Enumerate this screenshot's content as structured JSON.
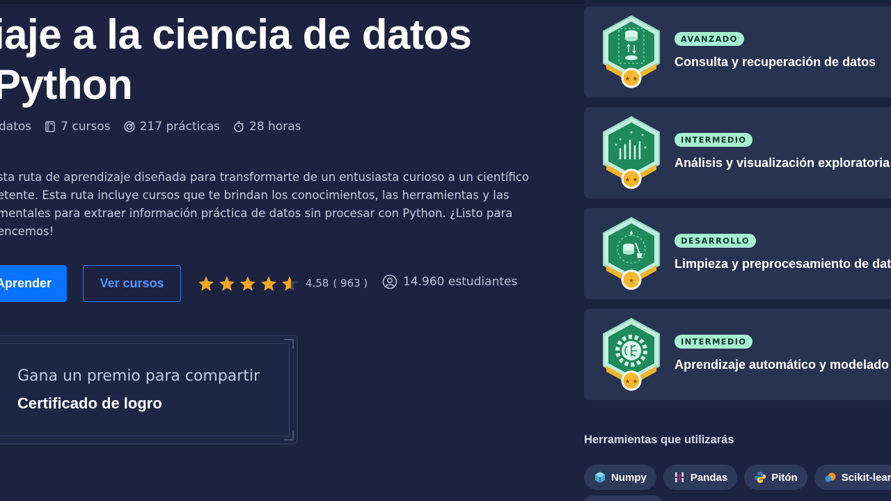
{
  "course": {
    "title_line1": "iaje a la ciencia de datos",
    "title_line2": "Python",
    "meta": [
      {
        "icon": "grid-icon",
        "text": "datos"
      },
      {
        "icon": "book-icon",
        "text": "7 cursos"
      },
      {
        "icon": "target-icon",
        "text": "217 prácticas"
      },
      {
        "icon": "stopwatch-icon",
        "text": "28 horas"
      }
    ],
    "description": "sta ruta de aprendizaje diseñada para transformarte de un entusiasta curioso a un científico\netente. Esta ruta incluye cursos que te brindan los conocimientos, las herramientas y las\nmentales para extraer información práctica de datos sin procesar con Python. ¿Listo para\nencemos!"
  },
  "actions": {
    "primary_label": "Aprender",
    "secondary_label": "Ver cursos",
    "rating_value": "4.58",
    "rating_count": "( 963 )",
    "rating_fraction": 0.916,
    "students": "14.960 estudiantes"
  },
  "certificate": {
    "subtitle": "Gana un premio para compartir",
    "title": "Certificado de logro"
  },
  "skills": [
    {
      "level": "AVANZADO",
      "title": "Consulta y recuperación de datos",
      "icon": "database-icon"
    },
    {
      "level": "INTERMEDIO",
      "title": "Análisis y visualización exploratoria",
      "icon": "bar-chart-icon"
    },
    {
      "level": "DESARROLLO",
      "title": "Limpieza y preprocesamiento de datos",
      "icon": "broom-database-icon"
    },
    {
      "level": "INTERMEDIO",
      "title": "Aprendizaje automático y modelado",
      "icon": "brain-gear-icon"
    }
  ],
  "tools": {
    "heading": "Herramientas que utilizarás",
    "items": [
      {
        "label": "Numpy",
        "icon": "numpy-icon"
      },
      {
        "label": "Pandas",
        "icon": "pandas-icon"
      },
      {
        "label": "Pitón",
        "icon": "python-icon"
      },
      {
        "label": "Scikit-learn",
        "icon": "scikit-learn-icon"
      }
    ]
  },
  "colors": {
    "background": "#1b2341",
    "card": "#283352",
    "primary": "#0a73ff",
    "star": "#f5a623",
    "badge_green": "#1f8a5b",
    "level_chip": "#a6f0d0"
  }
}
